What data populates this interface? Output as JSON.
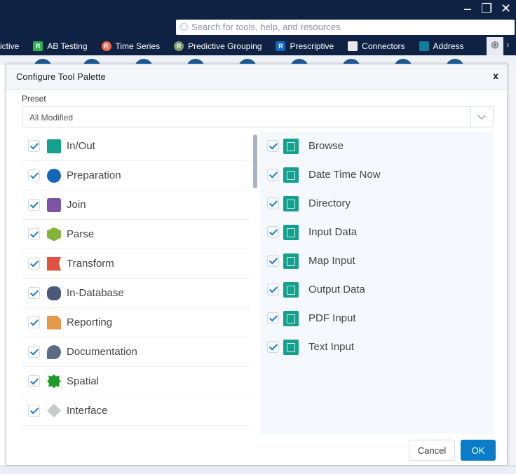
{
  "window": {
    "minimize": "‒",
    "restore": "❐",
    "close": "✕"
  },
  "search": {
    "placeholder": "Search for tools, help, and resources"
  },
  "tabs": [
    {
      "label": "ictive",
      "badge": "",
      "color": ""
    },
    {
      "label": "AB Testing",
      "badge": "R",
      "color": "#26b54a"
    },
    {
      "label": "Time Series",
      "badge": "R",
      "color": "#f26b4f"
    },
    {
      "label": "Predictive Grouping",
      "badge": "R",
      "color": "#7d9a6f"
    },
    {
      "label": "Prescriptive",
      "badge": "R",
      "color": "#1466c0"
    },
    {
      "label": "Connectors",
      "badge": "",
      "color": "#e8e8e8"
    },
    {
      "label": "Address",
      "badge": "",
      "color": "#0f7f9c"
    }
  ],
  "dialog": {
    "title": "Configure Tool Palette",
    "close": "x",
    "preset_label": "Preset",
    "preset_value": "All Modified",
    "categories": [
      {
        "label": "In/Out",
        "color": "#13a18e"
      },
      {
        "label": "Preparation",
        "color": "#1466b8"
      },
      {
        "label": "Join",
        "color": "#7d53a6"
      },
      {
        "label": "Parse",
        "color": "#86b43a"
      },
      {
        "label": "Transform",
        "color": "#e0523f"
      },
      {
        "label": "In-Database",
        "color": "#4a5a78"
      },
      {
        "label": "Reporting",
        "color": "#e39a4b"
      },
      {
        "label": "Documentation",
        "color": "#5b6b87"
      },
      {
        "label": "Spatial",
        "color": "#1f9b2c"
      },
      {
        "label": "Interface",
        "color": "#c6c9ce"
      }
    ],
    "tools": [
      "Browse",
      "Date Time Now",
      "Directory",
      "Input Data",
      "Map Input",
      "Output Data",
      "PDF Input",
      "Text Input"
    ],
    "cancel": "Cancel",
    "ok": "OK"
  }
}
